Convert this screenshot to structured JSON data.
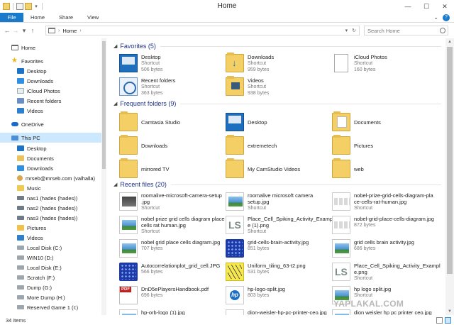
{
  "window": {
    "title": "Home"
  },
  "ribbon": {
    "tabs": [
      "File",
      "Home",
      "Share",
      "View"
    ]
  },
  "address": {
    "location": "Home",
    "search_placeholder": "Search Home"
  },
  "nav": [
    {
      "label": "Home",
      "icon": "home-icon",
      "indent": 0
    },
    {
      "label": "Favorites",
      "icon": "star-icon",
      "indent": 0
    },
    {
      "label": "Desktop",
      "icon": "desktop-icon",
      "indent": 1
    },
    {
      "label": "Downloads",
      "icon": "downloads-icon",
      "indent": 1
    },
    {
      "label": "iCloud Photos",
      "icon": "icloud-icon",
      "indent": 1
    },
    {
      "label": "Recent folders",
      "icon": "recent-folders-icon",
      "indent": 1
    },
    {
      "label": "Videos",
      "icon": "videos-icon",
      "indent": 1
    },
    {
      "label": "OneDrive",
      "icon": "onedrive-icon",
      "indent": 0
    },
    {
      "label": "This PC",
      "icon": "this-pc-icon",
      "indent": 0,
      "selected": true
    },
    {
      "label": "Desktop",
      "icon": "desktop-icon",
      "indent": 1
    },
    {
      "label": "Documents",
      "icon": "documents-icon",
      "indent": 1
    },
    {
      "label": "Downloads",
      "icon": "downloads-icon",
      "indent": 1
    },
    {
      "label": "mrseb@mrseb.com (valhalla)",
      "icon": "user-icon",
      "indent": 1
    },
    {
      "label": "Music",
      "icon": "music-icon",
      "indent": 1
    },
    {
      "label": "nas1 (hades (hades))",
      "icon": "network-drive-icon",
      "indent": 1
    },
    {
      "label": "nas2 (hades (hades))",
      "icon": "network-drive-icon",
      "indent": 1
    },
    {
      "label": "nas3 (hades (hades))",
      "icon": "network-drive-icon",
      "indent": 1
    },
    {
      "label": "Pictures",
      "icon": "pictures-icon",
      "indent": 1
    },
    {
      "label": "Videos",
      "icon": "videos-icon",
      "indent": 1
    },
    {
      "label": "Local Disk (C:)",
      "icon": "disk-icon",
      "indent": 1
    },
    {
      "label": "WIN10 (D:)",
      "icon": "disk-icon",
      "indent": 1
    },
    {
      "label": "Local Disk (E:)",
      "icon": "disk-icon",
      "indent": 1
    },
    {
      "label": "Scratch (F:)",
      "icon": "disk-icon",
      "indent": 1
    },
    {
      "label": "Dump (G:)",
      "icon": "disk-icon",
      "indent": 1
    },
    {
      "label": "More Dump (H:)",
      "icon": "disk-icon",
      "indent": 1
    },
    {
      "label": "Reserved Game 1 (I:)",
      "icon": "disk-icon",
      "indent": 1
    }
  ],
  "favorites": {
    "title": "Favorites (5)",
    "items": [
      {
        "name": "Desktop",
        "type": "Shortcut",
        "size": "506 bytes",
        "icon": "shortcut-icon"
      },
      {
        "name": "Downloads",
        "type": "Shortcut",
        "size": "959 bytes",
        "icon": "downloads-folder-icon"
      },
      {
        "name": "iCloud Photos",
        "type": "Shortcut",
        "size": "160 bytes",
        "icon": "blank-doc-icon"
      },
      {
        "name": "Recent folders",
        "type": "Shortcut",
        "size": "363 bytes",
        "icon": "recent-folders-icon"
      },
      {
        "name": "Videos",
        "type": "Shortcut",
        "size": "938 bytes",
        "icon": "videos-folder-icon"
      }
    ]
  },
  "frequent": {
    "title": "Frequent folders (9)",
    "items": [
      {
        "name": "Camtasia Studio",
        "icon": "folder-icon"
      },
      {
        "name": "Desktop",
        "icon": "shortcut-icon"
      },
      {
        "name": "Documents",
        "icon": "documents-folder-icon"
      },
      {
        "name": "Downloads",
        "icon": "folder-icon"
      },
      {
        "name": "extremetech",
        "icon": "folder-icon"
      },
      {
        "name": "Pictures",
        "icon": "folder-icon"
      },
      {
        "name": "mirrored TV",
        "icon": "folder-icon"
      },
      {
        "name": "My CamStudio Videos",
        "icon": "folder-icon"
      },
      {
        "name": "web",
        "icon": "folder-icon"
      }
    ]
  },
  "recent": {
    "title": "Recent files (20)",
    "items": [
      {
        "line1": "roomalive-microsoft-camera-setup",
        "line2": ".jpg",
        "sub": "Shortcut",
        "icon": "image-dark-icon"
      },
      {
        "line1": "roomalive microsoft camera",
        "line2": "setup.jpg",
        "sub": "Shortcut",
        "icon": "image-icon"
      },
      {
        "line1": "nobel-prize-grid-cells-diagram-pla",
        "line2": "ce-cells-rat-human.jpg",
        "sub": "Shortcut",
        "icon": "thumb-icon"
      },
      {
        "line1": "nobel prize grid cells diagram place",
        "line2": "cells rat human.jpg",
        "sub": "Shortcut",
        "icon": "image-icon"
      },
      {
        "line1": "Place_Cell_Spiking_Activity_Exampl",
        "line2": "e (1).png",
        "sub": "Shortcut",
        "icon": "ls-icon"
      },
      {
        "line1": "nobel-grid-place-cells-diagram.jpg",
        "line2": "",
        "sub": "872 bytes",
        "icon": "thumb-icon"
      },
      {
        "line1": "nobel grid place cells diagram.jpg",
        "line2": "",
        "sub": "707 bytes",
        "icon": "image-icon"
      },
      {
        "line1": "grid-cells-brain-activity.jpg",
        "line2": "",
        "sub": "851 bytes",
        "icon": "dots-icon"
      },
      {
        "line1": "grid cells brain activity.jpg",
        "line2": "",
        "sub": "686 bytes",
        "icon": "image-icon"
      },
      {
        "line1": "Autocorrelationplot_grid_cell.JPG",
        "line2": "",
        "sub": "566 bytes",
        "icon": "dots-icon"
      },
      {
        "line1": "Uniform_tiling_63-t2.png",
        "line2": "",
        "sub": "531 bytes",
        "icon": "tiling-icon"
      },
      {
        "line1": "Place_Cell_Spiking_Activity_Exampl",
        "line2": "e.png",
        "sub": "Shortcut",
        "icon": "ls-icon"
      },
      {
        "line1": "DnD5ePlayersHandbook.pdf",
        "line2": "",
        "sub": "696 bytes",
        "icon": "pdf-icon"
      },
      {
        "line1": "hp-logo-split.jpg",
        "line2": "",
        "sub": "803 bytes",
        "icon": "hp-icon"
      },
      {
        "line1": "hp logo split.jpg",
        "line2": "",
        "sub": "Shortcut",
        "icon": "image-icon"
      },
      {
        "line1": "hp-orb-logo (1).jpg",
        "line2": "",
        "sub": "",
        "icon": "image-icon"
      },
      {
        "line1": "dion-weisler-hp-pc-printer-ceo.jpg",
        "line2": "",
        "sub": "",
        "icon": "thumb-icon"
      },
      {
        "line1": "dion weisler hp pc printer ceo.jpg",
        "line2": "",
        "sub": "",
        "icon": "image-icon"
      }
    ]
  },
  "status": {
    "count": "34 items"
  },
  "watermark": "YAPLAKAL.COM"
}
